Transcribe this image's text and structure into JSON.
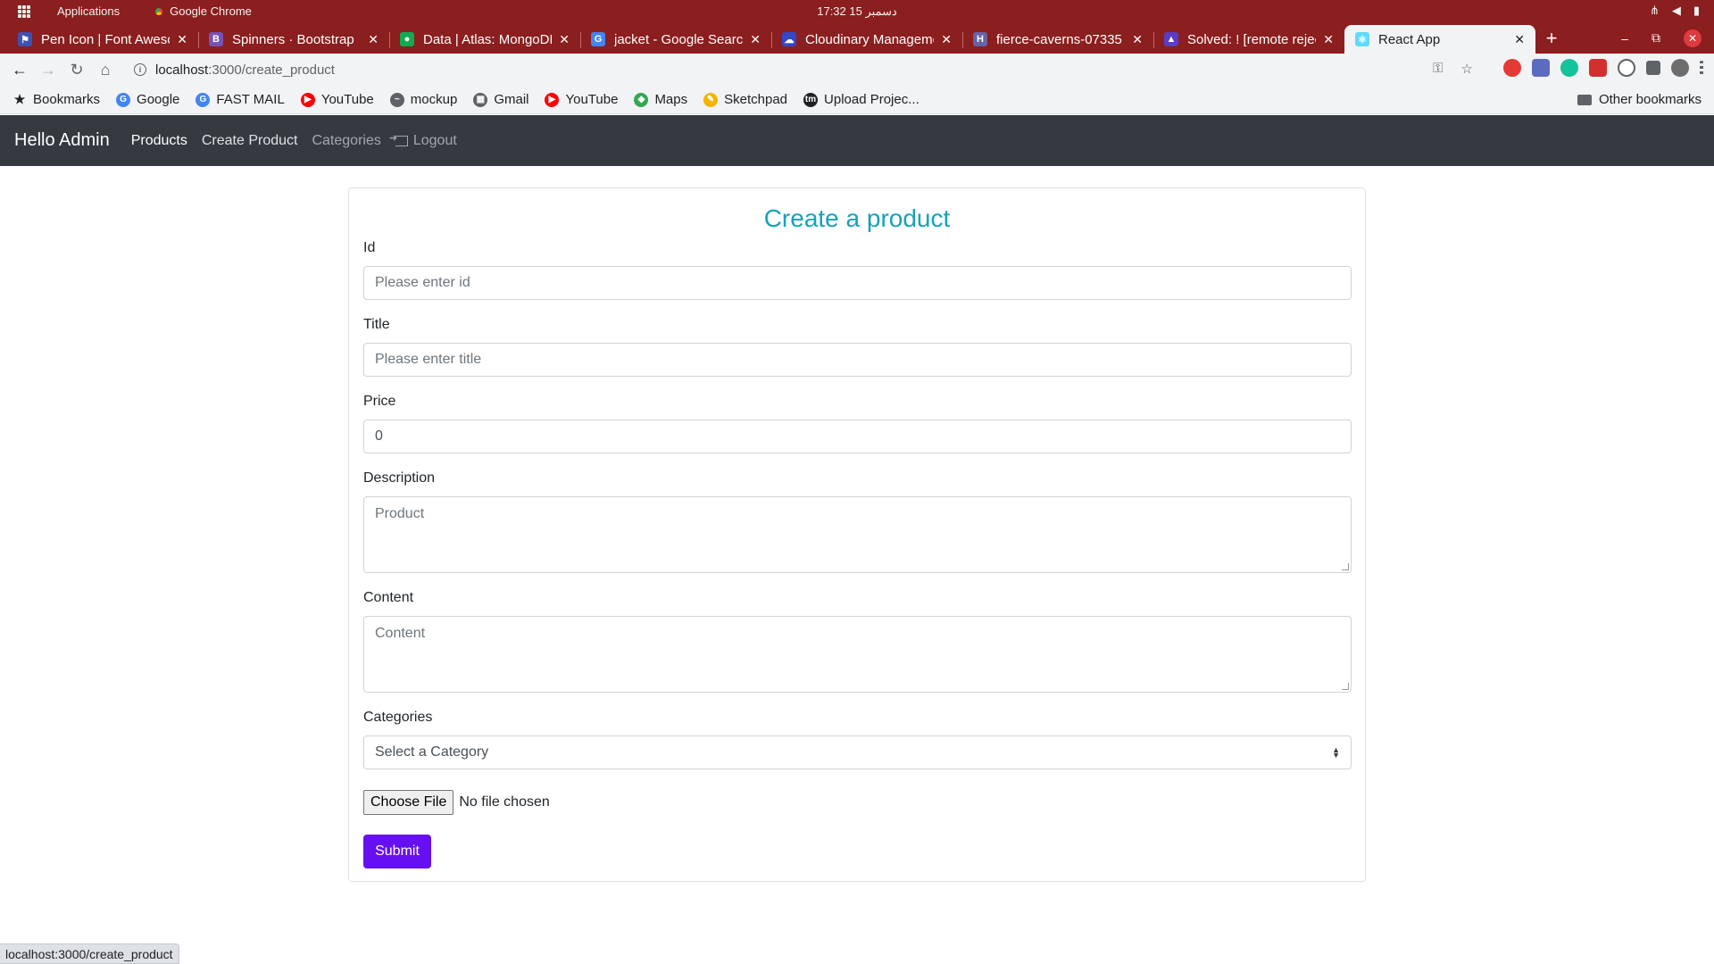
{
  "os": {
    "apps_label": "Applications",
    "active_app": "Google Chrome",
    "clock": "17:32  15 دسمبر"
  },
  "tabs": [
    {
      "title": "Pen Icon | Font Awesome",
      "color": "#3f51b5",
      "glyph": "⚑"
    },
    {
      "title": "Spinners · Bootstrap",
      "color": "#7952b3",
      "glyph": "B"
    },
    {
      "title": "Data | Atlas: MongoDB",
      "color": "#13aa52",
      "glyph": "●"
    },
    {
      "title": "jacket - Google Search",
      "color": "#4285f4",
      "glyph": "G"
    },
    {
      "title": "Cloudinary Management",
      "color": "#3448c5",
      "glyph": "☁"
    },
    {
      "title": "fierce-caverns-07335",
      "color": "#6762a6",
      "glyph": "H"
    },
    {
      "title": "Solved: ! [remote rejected]",
      "color": "#5b3cc4",
      "glyph": "▲"
    },
    {
      "title": "React App",
      "color": "#61dafb",
      "glyph": "⚛"
    }
  ],
  "address": {
    "host": "localhost",
    "path": ":3000/create_product"
  },
  "bookmarks": [
    {
      "label": "Bookmarks",
      "color": "#202124",
      "glyph": "★"
    },
    {
      "label": "Google",
      "color": "#4285f4",
      "glyph": "G"
    },
    {
      "label": "FAST MAIL",
      "color": "#4285f4",
      "glyph": "G"
    },
    {
      "label": "YouTube",
      "color": "#ff0000",
      "glyph": "▶"
    },
    {
      "label": "mockup",
      "color": "#5f6368",
      "glyph": "~"
    },
    {
      "label": "Gmail",
      "color": "#5f6368",
      "glyph": "▦"
    },
    {
      "label": "YouTube",
      "color": "#ff0000",
      "glyph": "▶"
    },
    {
      "label": "Maps",
      "color": "#34a853",
      "glyph": "◆"
    },
    {
      "label": "Sketchpad",
      "color": "#f4b400",
      "glyph": "✎"
    },
    {
      "label": "Upload Projec...",
      "color": "#202124",
      "glyph": "tm"
    }
  ],
  "other_bookmarks": "Other bookmarks",
  "navbar": {
    "brand": "Hello Admin",
    "links": {
      "products": "Products",
      "create_product": "Create Product",
      "categories": "Categories",
      "logout": "Logout"
    }
  },
  "form": {
    "title": "Create a product",
    "id": {
      "label": "Id",
      "placeholder": "Please enter id"
    },
    "title_field": {
      "label": "Title",
      "placeholder": "Please enter title"
    },
    "price": {
      "label": "Price",
      "value": "0"
    },
    "description": {
      "label": "Description",
      "value": "Product"
    },
    "content": {
      "label": "Content",
      "placeholder": "Content"
    },
    "categories": {
      "label": "Categories",
      "selected": "Select a Category"
    },
    "file": {
      "button": "Choose File",
      "status": "No file chosen"
    },
    "submit": "Submit"
  },
  "status_url": "localhost:3000/create_product",
  "colors": {
    "os_bar": "#8b1e1e",
    "navbar": "#343a40",
    "title": "#17a2b8",
    "submit": "#6610f2"
  }
}
